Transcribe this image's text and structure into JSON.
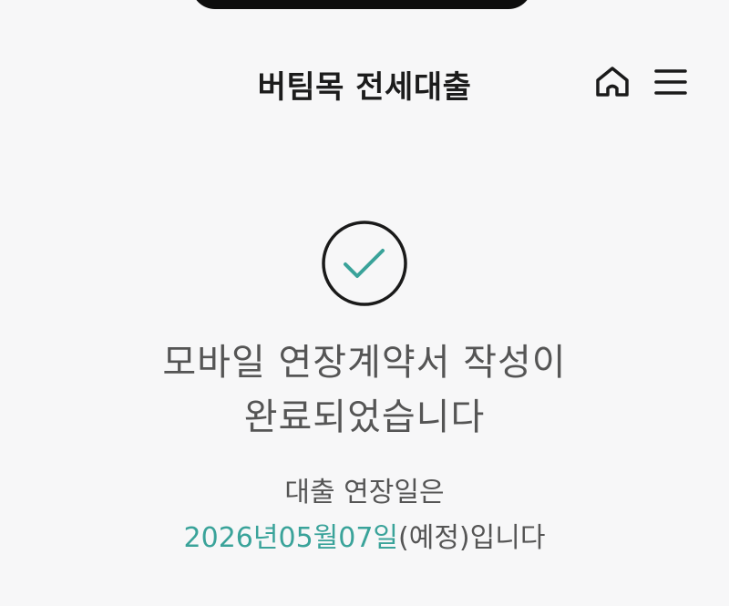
{
  "header": {
    "title": "버팀목 전세대출",
    "home_icon": "home-icon",
    "menu_icon": "menu-icon"
  },
  "result": {
    "status_icon": "check-circle-icon",
    "accent_color": "#3aa39a",
    "headline_line1": "모바일 연장계약서 작성이",
    "headline_line2": "완료되었습니다",
    "extension_label": "대출 연장일은",
    "extension_date": "2026년05월07일",
    "extension_suffix": "(예정)입니다"
  }
}
